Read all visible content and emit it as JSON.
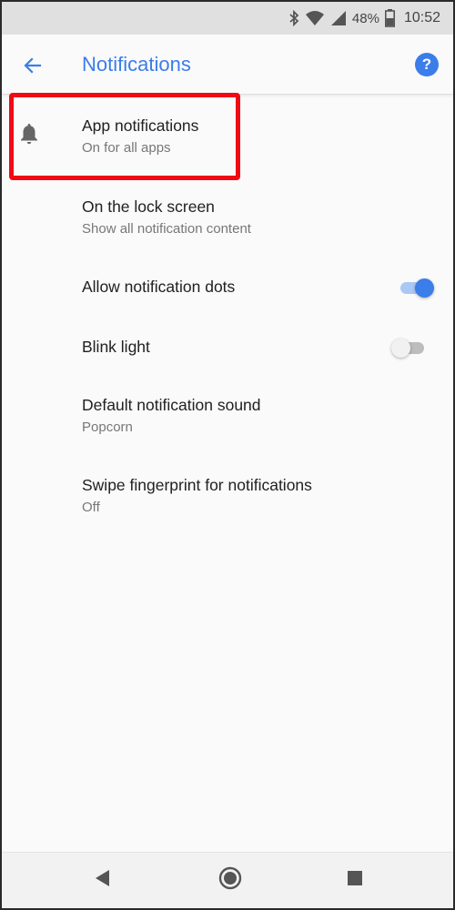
{
  "status_bar": {
    "battery": "48%",
    "time": "10:52",
    "icons": [
      "bluetooth-icon",
      "wifi-icon",
      "signal-icon",
      "battery-icon"
    ]
  },
  "app_bar": {
    "title": "Notifications",
    "back_icon": "arrow-left-icon",
    "help_icon": "help-icon",
    "help_glyph": "?",
    "accent_color": "#3b7de9"
  },
  "settings": [
    {
      "title": "App notifications",
      "subtitle": "On for all apps",
      "icon": "bell-icon",
      "highlighted": true
    },
    {
      "title": "On the lock screen",
      "subtitle": "Show all notification content"
    },
    {
      "title": "Allow notification dots",
      "toggle": true
    },
    {
      "title": "Blink light",
      "toggle": false
    },
    {
      "title": "Default notification sound",
      "subtitle": "Popcorn"
    },
    {
      "title": "Swipe fingerprint for notifications",
      "subtitle": "Off"
    }
  ],
  "highlight_color": "#f00a14",
  "nav_bar": {
    "buttons": [
      "back-triangle-icon",
      "home-circle-icon",
      "recents-square-icon"
    ]
  }
}
